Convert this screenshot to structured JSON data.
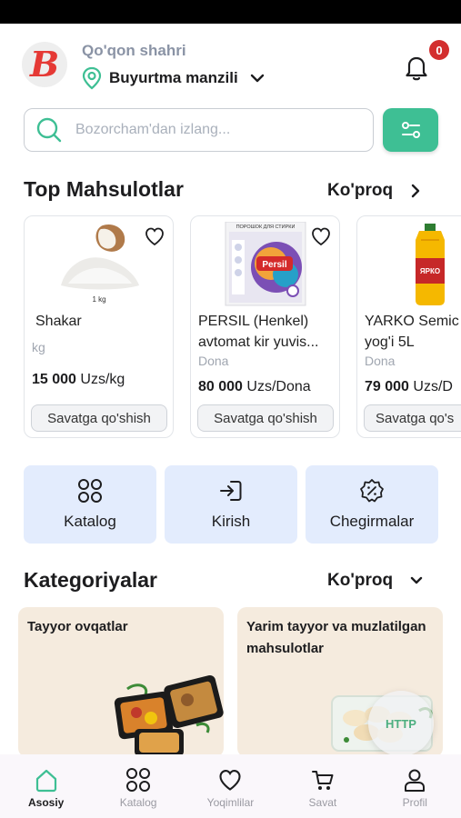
{
  "header": {
    "logo_letter": "B",
    "city": "Qo'qon shahri",
    "address_label": "Buyurtma manzili",
    "notifications_count": "0"
  },
  "search": {
    "placeholder": "Bozorcham'dan izlang..."
  },
  "top_products": {
    "title": "Top Mahsulotlar",
    "more_label": "Ko'proq",
    "items": [
      {
        "name": "Shakar",
        "unit": "kg",
        "price": "15 000",
        "price_suffix": " Uzs/kg",
        "image_caption": "1 kg",
        "add_label": "Savatga qo'shish"
      },
      {
        "name": "PERSIL (Henkel) avtomat kir yuvis...",
        "unit": "Dona",
        "price": "80 000",
        "price_suffix": " Uzs/Dona",
        "image_caption": "ПОРОШОК ДЛЯ СТИРКИ",
        "add_label": "Savatga qo'shish"
      },
      {
        "name": "YARKO Semic yog'i 5L",
        "unit": "Dona",
        "price": "79 000",
        "price_suffix": " Uzs/D",
        "image_caption": "",
        "add_label": "Savatga qo's"
      }
    ]
  },
  "quick_actions": [
    {
      "label": "Katalog",
      "icon": "grid-icon"
    },
    {
      "label": "Kirish",
      "icon": "login-icon"
    },
    {
      "label": "Chegirmalar",
      "icon": "discount-badge-icon"
    }
  ],
  "categories": {
    "title": "Kategoriyalar",
    "more_label": "Ko'proq",
    "items": [
      {
        "name": "Tayyor ovqatlar"
      },
      {
        "name": "Yarim tayyor va muzlatilgan mahsulotlar"
      }
    ]
  },
  "floating_badge": "HTTP",
  "bottom_nav": [
    {
      "label": "Asosiy",
      "icon": "home-icon",
      "active": true
    },
    {
      "label": "Katalog",
      "icon": "grid-icon",
      "active": false
    },
    {
      "label": "Yoqimlilar",
      "icon": "heart-icon",
      "active": false
    },
    {
      "label": "Savat",
      "icon": "cart-icon",
      "active": false
    },
    {
      "label": "Profil",
      "icon": "user-icon",
      "active": false
    }
  ],
  "colors": {
    "accent": "#3ebf94",
    "badge": "#d32f2f",
    "quick_bg": "#e3ecfd",
    "logo": "#e53935"
  }
}
